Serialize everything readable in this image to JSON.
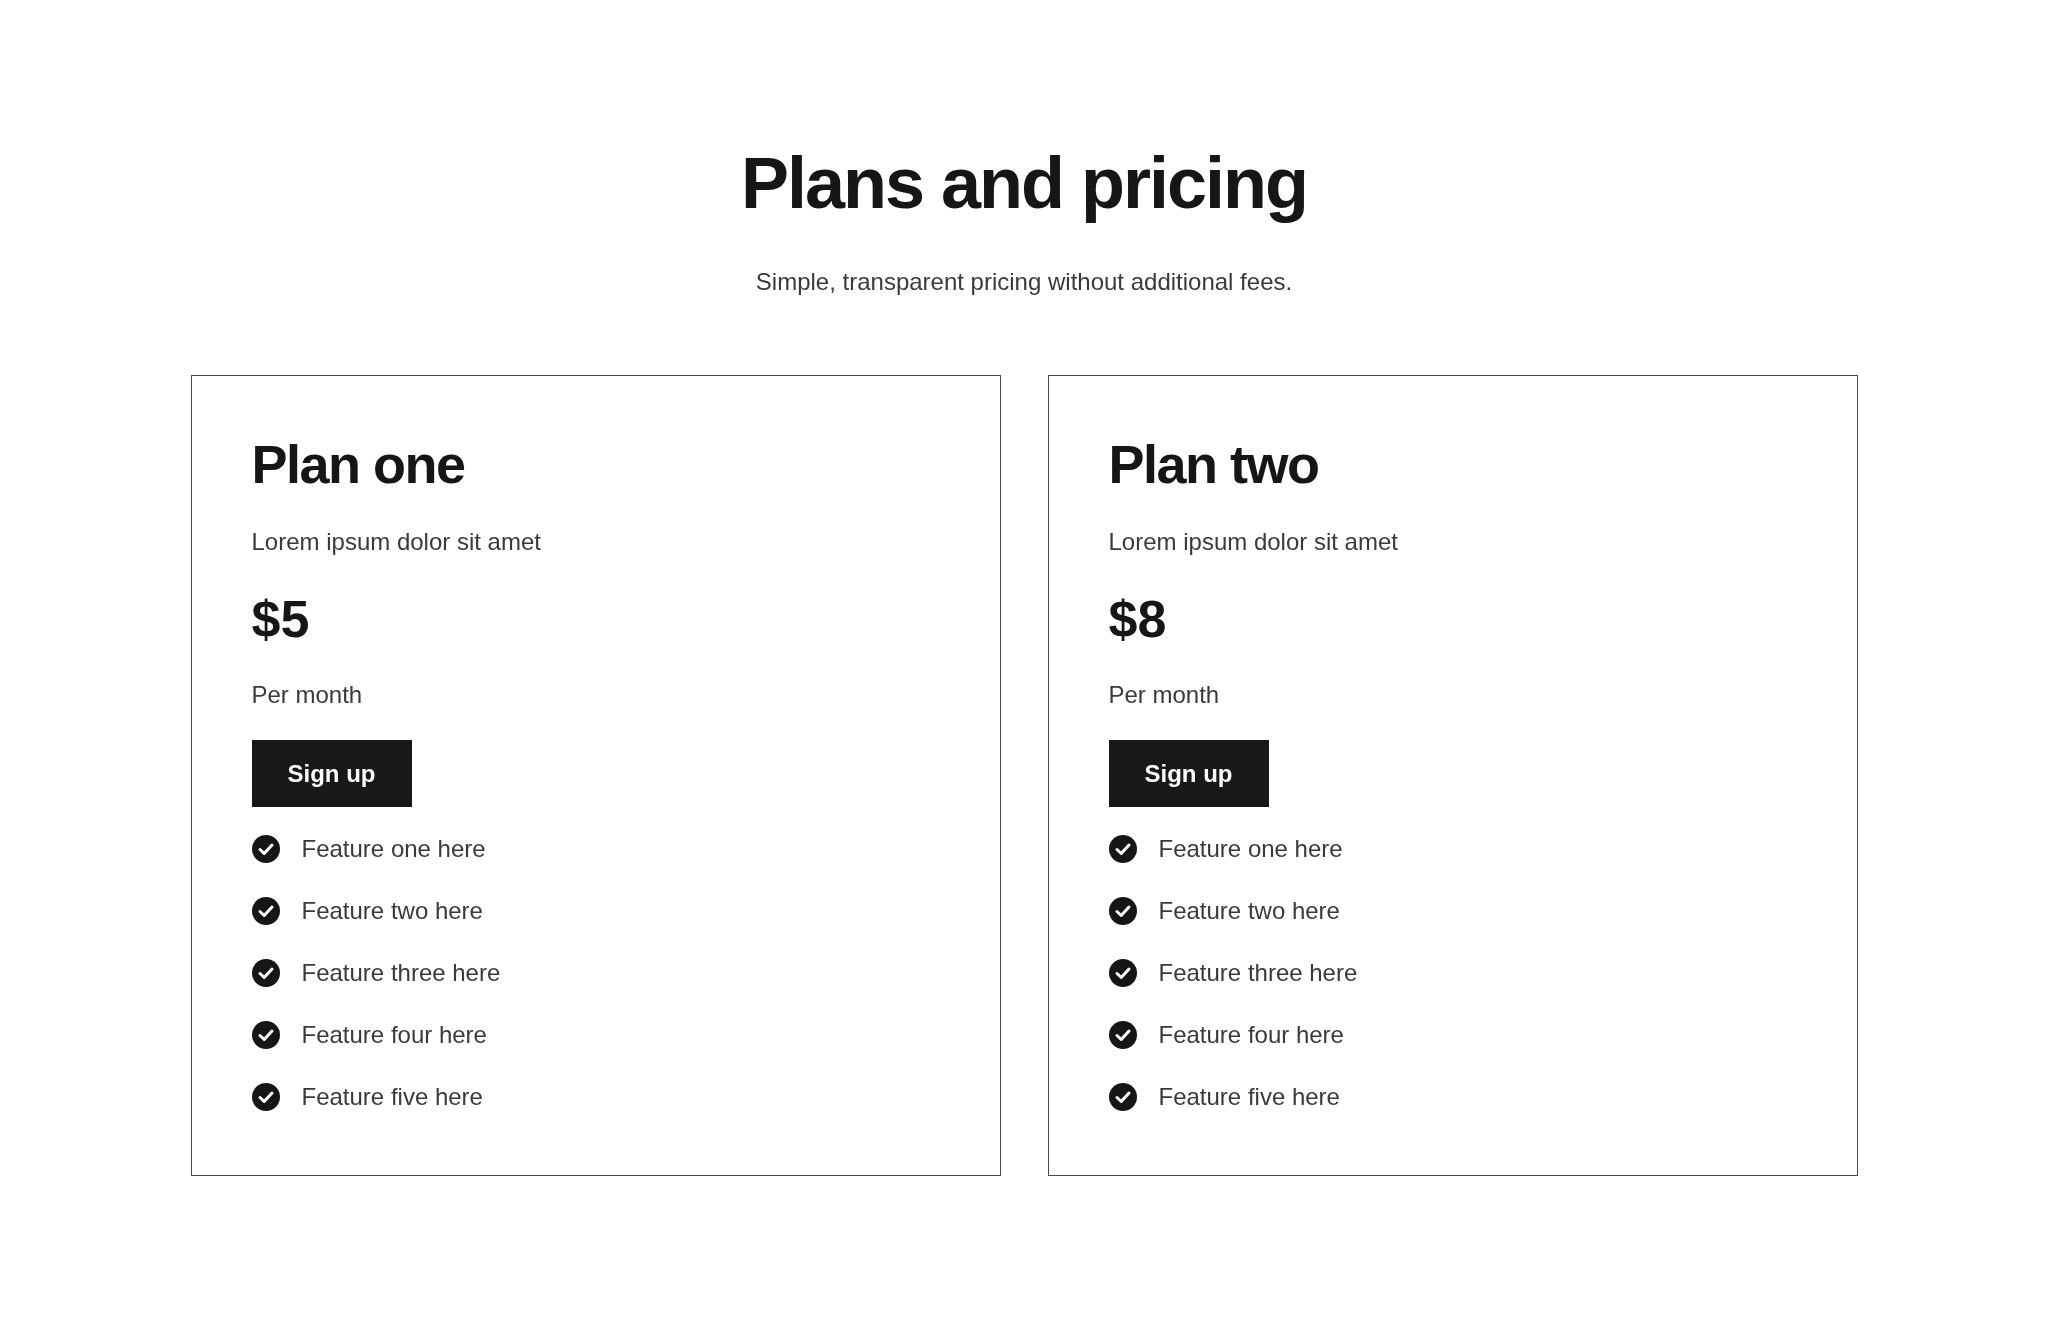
{
  "header": {
    "title": "Plans and pricing",
    "subtitle": "Simple, transparent pricing without additional fees."
  },
  "plans": [
    {
      "name": "Plan one",
      "description": "Lorem ipsum dolor sit amet",
      "price": "$5",
      "period": "Per month",
      "button": "Sign up",
      "features": [
        "Feature one here",
        "Feature two here",
        "Feature three here",
        "Feature four here",
        "Feature five here"
      ]
    },
    {
      "name": "Plan two",
      "description": "Lorem ipsum dolor sit amet",
      "price": "$8",
      "period": "Per month",
      "button": "Sign up",
      "features": [
        "Feature one here",
        "Feature two here",
        "Feature three here",
        "Feature four here",
        "Feature five here"
      ]
    }
  ]
}
